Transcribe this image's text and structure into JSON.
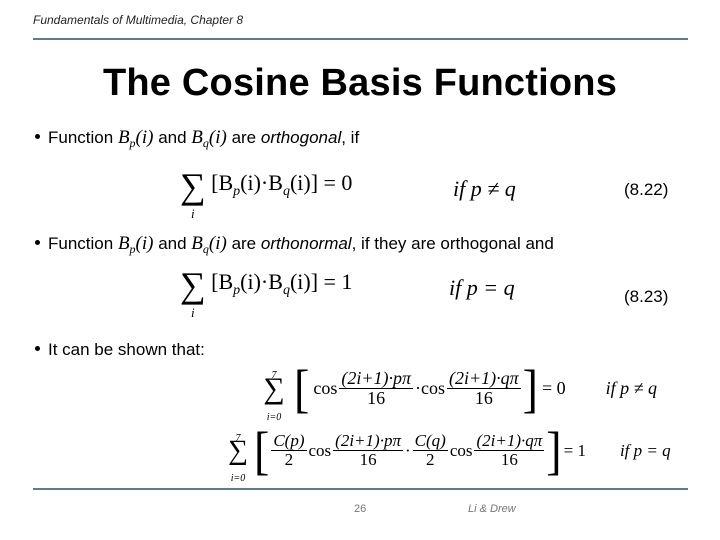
{
  "header": {
    "text": "Fundamentals of Multimedia, Chapter 8"
  },
  "slide": {
    "title": "The Cosine Basis Functions",
    "bullets": [
      {
        "prefix": "Function ",
        "f1": "B",
        "f1_sub": "p",
        "f1_arg": "(i)",
        "mid": " and ",
        "f2": "B",
        "f2_sub": "q",
        "f2_arg": "(i)",
        "are": " are ",
        "term": "orthogonal",
        "suffix": ", if"
      },
      {
        "prefix": "Function ",
        "f1": "B",
        "f1_sub": "p",
        "f1_arg": "(i)",
        "mid": " and ",
        "f2": "B",
        "f2_sub": "q",
        "f2_arg": "(i)",
        "are": " are ",
        "term": "orthonormal",
        "suffix": ", if they are orthogonal and"
      },
      {
        "text": "It can be shown that:"
      }
    ],
    "equations": [
      {
        "sum_index": "i",
        "body_left": "[B",
        "sub_p": "p",
        "mid": "(i)·B",
        "sub_q": "q",
        "body_right": "(i)] = 0",
        "condition": "if  p ≠ q",
        "number": "(8.22)"
      },
      {
        "sum_index": "i",
        "body_left": "[B",
        "sub_p": "p",
        "mid": "(i)·B",
        "sub_q": "q",
        "body_right": "(i)] = 1",
        "condition": "if  p = q",
        "number": "(8.23)"
      },
      {
        "upper": "7",
        "lower": "i=0",
        "cos": "cos",
        "frac1_num": "(2i+1)·pπ",
        "frac1_den": "16",
        "dot": "·",
        "frac2_num": "(2i+1)·qπ",
        "frac2_den": "16",
        "result": "= 0",
        "condition": "if  p ≠ q"
      },
      {
        "upper": "7",
        "lower": "i=0",
        "c1_num": "C(p)",
        "c1_den": "2",
        "cos": "cos",
        "frac1_num": "(2i+1)·pπ",
        "frac1_den": "16",
        "dot": "·",
        "c2_num": "C(q)",
        "c2_den": "2",
        "frac2_num": "(2i+1)·qπ",
        "frac2_den": "16",
        "result": "= 1",
        "condition": "if  p = q"
      }
    ]
  },
  "footer": {
    "page_number": "26",
    "authors": "Li & Drew"
  },
  "colors": {
    "rule": "#5b7d8f"
  }
}
